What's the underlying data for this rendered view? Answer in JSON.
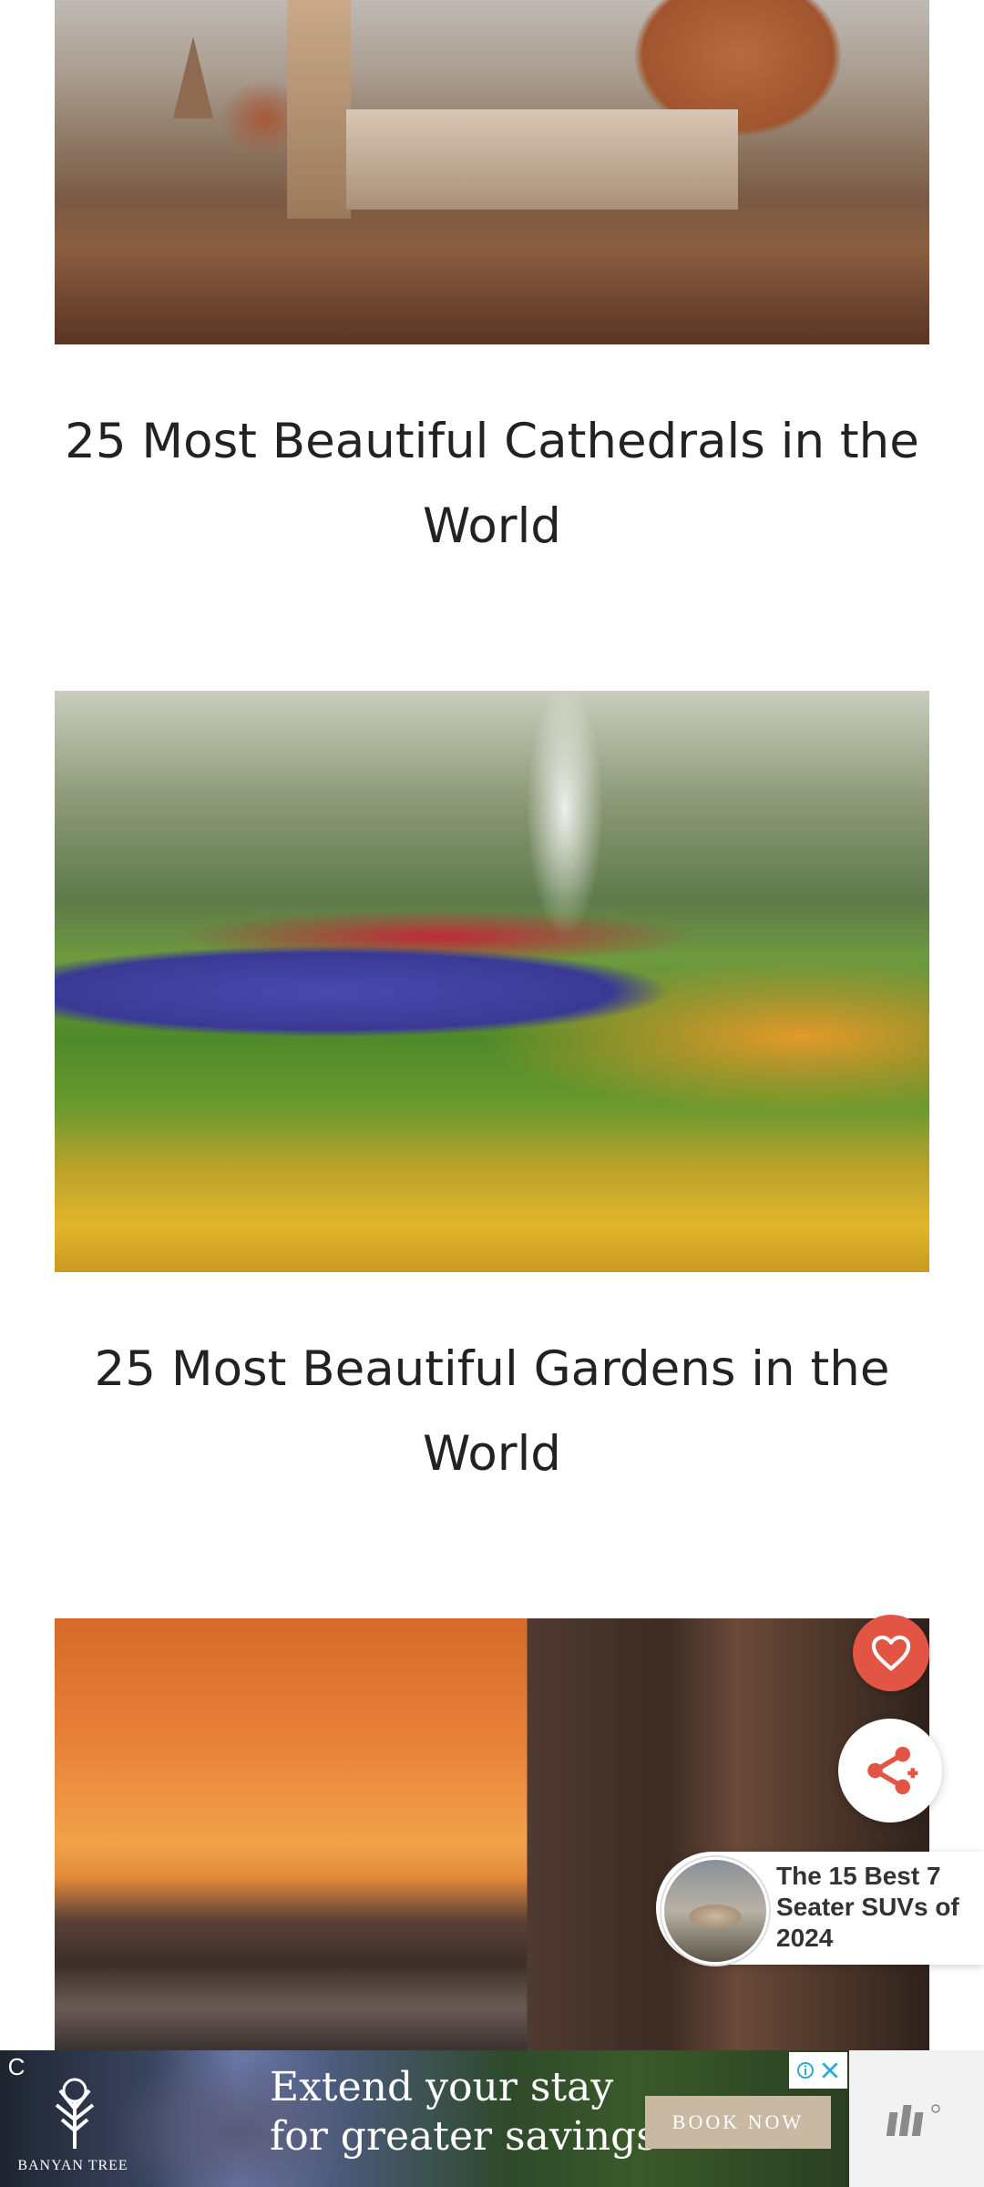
{
  "articles": [
    {
      "title": "25 Most Beautiful Cathedrals in the World",
      "image": "cathedral-photo"
    },
    {
      "title": "25 Most Beautiful Gardens in the World",
      "image": "garden-photo"
    },
    {
      "title": "",
      "image": "hotel-sunset-photo"
    }
  ],
  "floating": {
    "heart_icon": "heart-icon",
    "share_icon": "share-icon",
    "heart_color": "#e25545",
    "share_color": "#e25545"
  },
  "promo": {
    "text": "The 15 Best 7 Seater SUVs of 2024",
    "thumb": "suv-thumbnail"
  },
  "ad": {
    "brand": "BANYAN TREE",
    "headline_line1": "Extend your stay",
    "headline_line2": "for greater savings",
    "cta": "BOOK NOW",
    "corner_mark": "C"
  }
}
